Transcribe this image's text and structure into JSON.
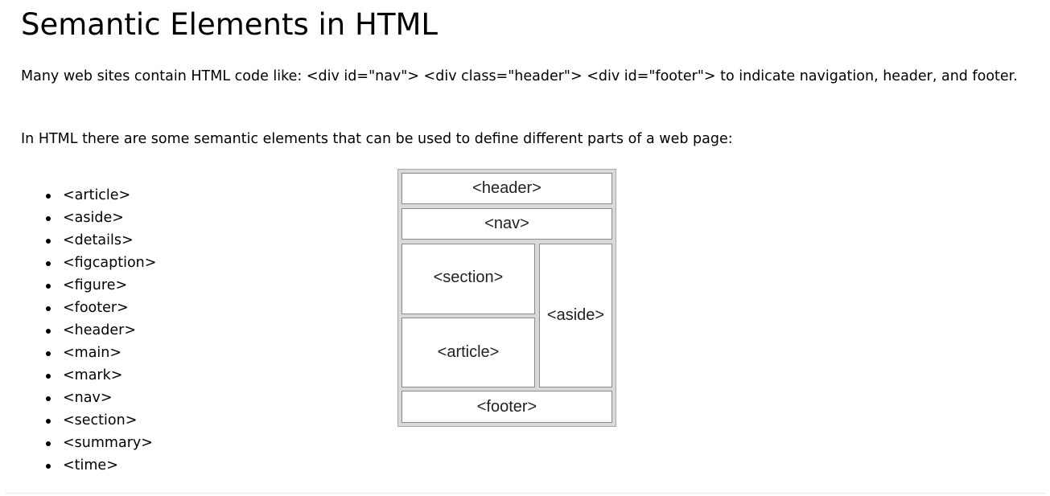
{
  "title": "Semantic Elements in HTML",
  "paragraphs": [
    "Many web sites contain HTML code like: <div id=\"nav\"> <div class=\"header\"> <div id=\"footer\"> to indicate navigation, header, and footer.",
    "In HTML there are some semantic elements that can be used to define different parts of a web page:"
  ],
  "elements_list": [
    "<article>",
    "<aside>",
    "<details>",
    "<figcaption>",
    "<figure>",
    "<footer>",
    "<header>",
    "<main>",
    "<mark>",
    "<nav>",
    "<section>",
    "<summary>",
    "<time>"
  ],
  "diagram": {
    "header": "<header>",
    "nav": "<nav>",
    "section": "<section>",
    "article": "<article>",
    "aside": "<aside>",
    "footer": "<footer>"
  }
}
